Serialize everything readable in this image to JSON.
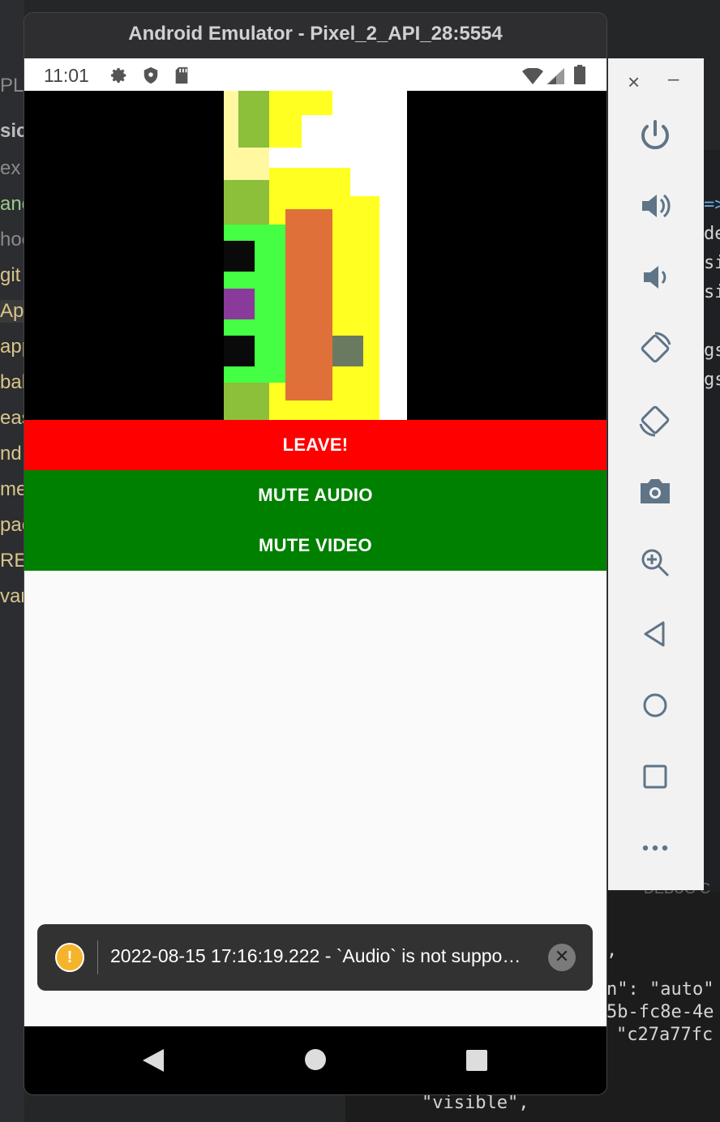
{
  "emulator": {
    "title": "Android Emulator - Pixel_2_API_28:5554"
  },
  "status_bar": {
    "time": "11:01"
  },
  "buttons": {
    "leave": "LEAVE!",
    "mute_audio": "MUTE AUDIO",
    "mute_video": "MUTE VIDEO"
  },
  "toast": {
    "icon": "warning-icon",
    "message": "2022-08-15 17:16:19.222 - `Audio` is not suppo…"
  },
  "toolbar": {
    "close": "×",
    "minimize": "–",
    "items": [
      "power-icon",
      "volume-up-icon",
      "volume-down-icon",
      "rotate-left-icon",
      "rotate-right-icon",
      "camera-icon",
      "zoom-icon",
      "back-icon",
      "home-icon",
      "overview-icon",
      "more-icon"
    ]
  },
  "ide": {
    "left_fragments": [
      "PLO",
      "sic",
      "ex",
      "and",
      "hoo",
      "git",
      "Ap",
      "app",
      "bal",
      "eas",
      "nd",
      "me",
      "pac",
      "REA",
      "var"
    ],
    "right_fragments": [
      "=>",
      "de",
      "si",
      "si",
      "gs",
      "gs",
      "DEBUG C",
      ",",
      "n\": \"auto\"",
      "5b-fc8e-4e",
      "\"c27a77fc",
      "\"visible\","
    ]
  },
  "colors": {
    "leave": "#ff0000",
    "mute": "#008000",
    "toast_bg": "#323232",
    "warning": "#f6b42a"
  }
}
